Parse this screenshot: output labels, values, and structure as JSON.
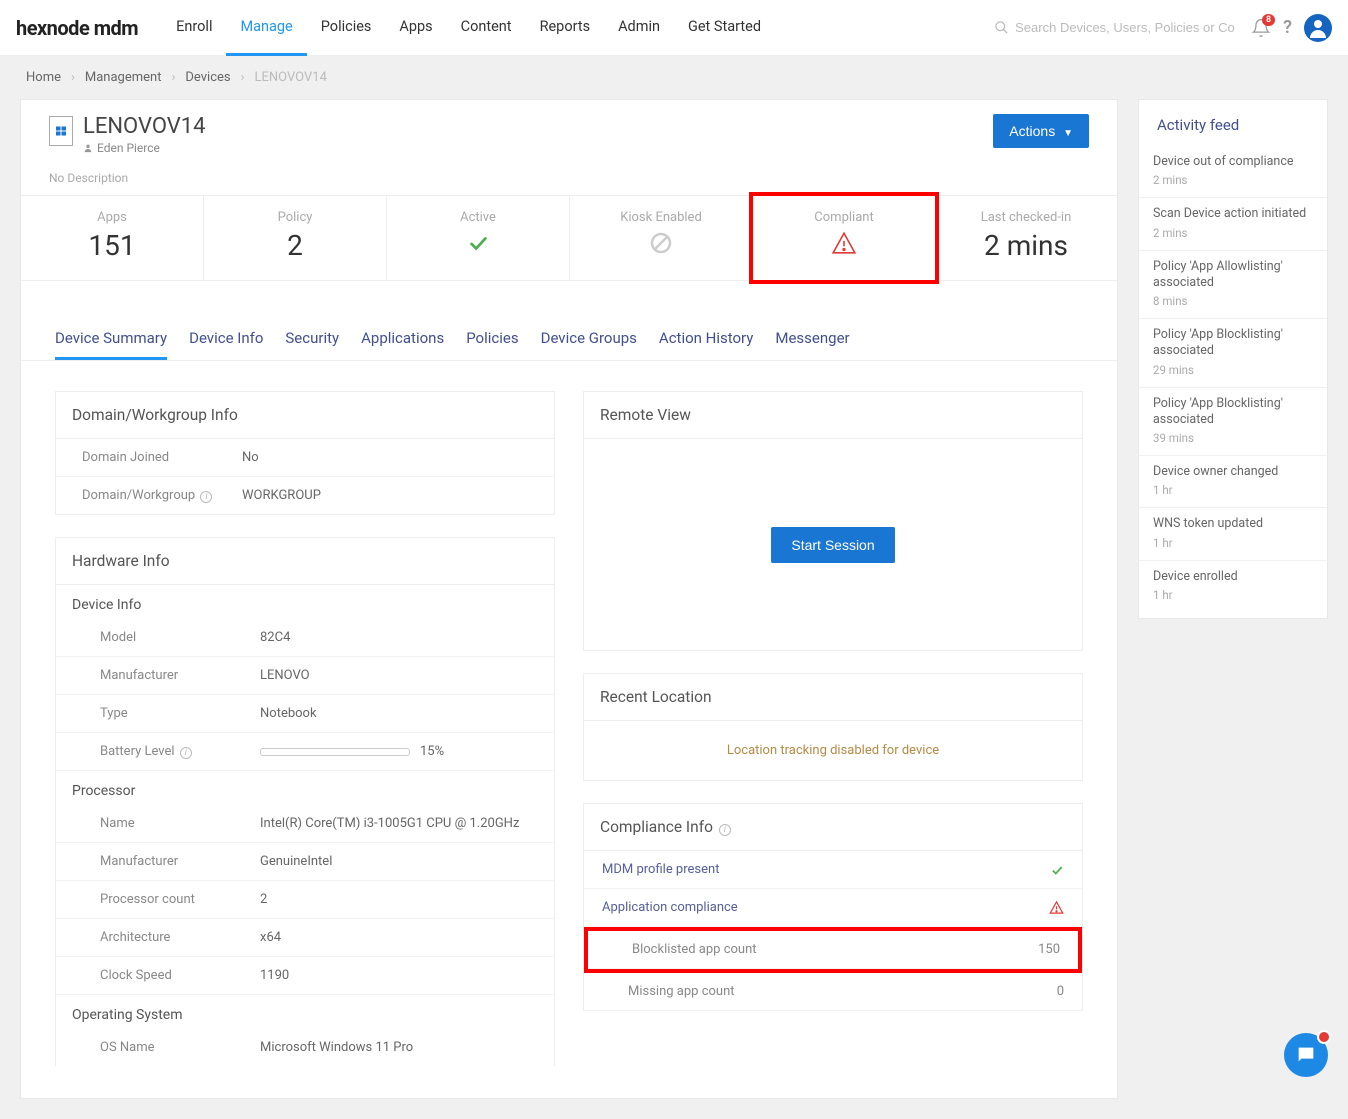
{
  "brand": "hexnode mdm",
  "nav": [
    "Enroll",
    "Manage",
    "Policies",
    "Apps",
    "Content",
    "Reports",
    "Admin",
    "Get Started"
  ],
  "nav_active": 1,
  "search_placeholder": "Search Devices, Users, Policies or Content",
  "notify_count": "8",
  "breadcrumb": {
    "home": "Home",
    "mgmt": "Management",
    "devices": "Devices",
    "current": "LENOVOV14"
  },
  "device": {
    "name": "LENOVOV14",
    "owner": "Eden Pierce",
    "desc": "No Description"
  },
  "actions_label": "Actions",
  "stats": {
    "apps_label": "Apps",
    "apps_val": "151",
    "policy_label": "Policy",
    "policy_val": "2",
    "active_label": "Active",
    "kiosk_label": "Kiosk Enabled",
    "compliant_label": "Compliant",
    "checked_label": "Last checked-in",
    "checked_val": "2 mins"
  },
  "tabs": [
    "Device Summary",
    "Device Info",
    "Security",
    "Applications",
    "Policies",
    "Device Groups",
    "Action History",
    "Messenger"
  ],
  "tabs_active": 0,
  "domain_panel": {
    "title": "Domain/Workgroup Info",
    "rows": [
      {
        "label": "Domain Joined",
        "val": "No"
      },
      {
        "label": "Domain/Workgroup",
        "val": "WORKGROUP",
        "info": true
      }
    ]
  },
  "hw_panel": {
    "title": "Hardware Info",
    "device_section": "Device Info",
    "device_rows": [
      {
        "label": "Model",
        "val": "82C4"
      },
      {
        "label": "Manufacturer",
        "val": "LENOVO"
      },
      {
        "label": "Type",
        "val": "Notebook"
      }
    ],
    "battery_label": "Battery Level",
    "battery_pct": "15%",
    "battery_fill": 15,
    "proc_section": "Processor",
    "proc_rows": [
      {
        "label": "Name",
        "val": "Intel(R) Core(TM) i3-1005G1 CPU @ 1.20GHz"
      },
      {
        "label": "Manufacturer",
        "val": "GenuineIntel"
      },
      {
        "label": "Processor count",
        "val": "2"
      },
      {
        "label": "Architecture",
        "val": "x64"
      },
      {
        "label": "Clock Speed",
        "val": "1190"
      }
    ],
    "os_section": "Operating System",
    "os_rows": [
      {
        "label": "OS Name",
        "val": "Microsoft Windows 11 Pro"
      }
    ]
  },
  "remote": {
    "title": "Remote View",
    "btn": "Start Session"
  },
  "location": {
    "title": "Recent Location",
    "msg": "Location tracking disabled for device"
  },
  "compliance": {
    "title": "Compliance Info",
    "mdm": "MDM profile present",
    "app": "Application compliance",
    "block_label": "Blocklisted app count",
    "block_val": "150",
    "miss_label": "Missing app count",
    "miss_val": "0"
  },
  "activity": {
    "title": "Activity feed",
    "items": [
      {
        "text": "Device out of compliance",
        "time": "2 mins"
      },
      {
        "text": "Scan Device action initiated",
        "time": "2 mins"
      },
      {
        "text": "Policy 'App Allowlisting' associated",
        "time": "8 mins"
      },
      {
        "text": "Policy 'App Blocklisting' associated",
        "time": "29 mins"
      },
      {
        "text": "Policy 'App Blocklisting' associated",
        "time": "39 mins"
      },
      {
        "text": "Device owner changed",
        "time": "1 hr"
      },
      {
        "text": "WNS token updated",
        "time": "1 hr"
      },
      {
        "text": "Device enrolled",
        "time": "1 hr"
      }
    ]
  }
}
